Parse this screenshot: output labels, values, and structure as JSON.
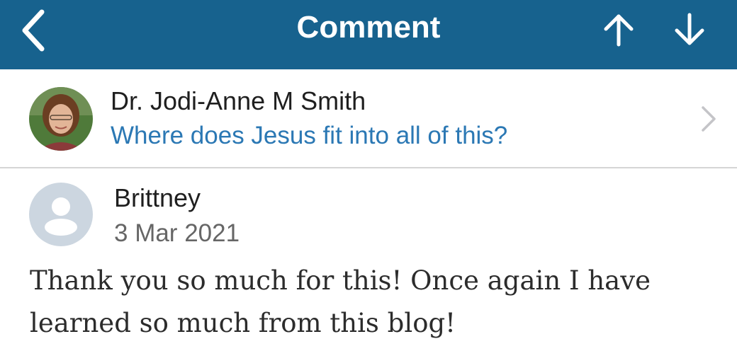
{
  "header": {
    "title": "Comment",
    "back_icon": "chevron-left-icon",
    "prev_icon": "arrow-up-icon",
    "next_icon": "arrow-down-icon",
    "background_color": "#17628e"
  },
  "post": {
    "author": "Dr. Jodi-Anne M Smith",
    "title": "Where does Jesus fit into all of this?",
    "title_color": "#2b78b4",
    "chevron_icon": "chevron-right-icon"
  },
  "comment": {
    "author": "Brittney",
    "date": "3 Mar 2021",
    "body": "Thank you so much for this! Once again I have learned so much from this blog!",
    "avatar_icon": "user-placeholder-icon"
  }
}
